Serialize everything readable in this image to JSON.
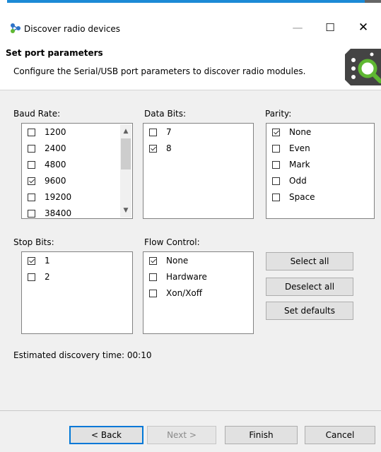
{
  "window": {
    "title": "Discover radio devices",
    "minimize_glyph": "—",
    "maximize_glyph": "☐",
    "close_glyph": "✕"
  },
  "header": {
    "title": "Set port parameters",
    "description": "Configure the Serial/USB port parameters to discover radio modules."
  },
  "baud_rate": {
    "label": "Baud Rate:",
    "items": [
      {
        "label": "1200",
        "checked": false
      },
      {
        "label": "2400",
        "checked": false
      },
      {
        "label": "4800",
        "checked": false
      },
      {
        "label": "9600",
        "checked": true
      },
      {
        "label": "19200",
        "checked": false
      },
      {
        "label": "38400",
        "checked": false
      }
    ]
  },
  "data_bits": {
    "label": "Data Bits:",
    "items": [
      {
        "label": "7",
        "checked": false
      },
      {
        "label": "8",
        "checked": true
      }
    ]
  },
  "parity": {
    "label": "Parity:",
    "items": [
      {
        "label": "None",
        "checked": true
      },
      {
        "label": "Even",
        "checked": false
      },
      {
        "label": "Mark",
        "checked": false
      },
      {
        "label": "Odd",
        "checked": false
      },
      {
        "label": "Space",
        "checked": false
      }
    ]
  },
  "stop_bits": {
    "label": "Stop Bits:",
    "items": [
      {
        "label": "1",
        "checked": true
      },
      {
        "label": "2",
        "checked": false
      }
    ]
  },
  "flow_control": {
    "label": "Flow Control:",
    "items": [
      {
        "label": "None",
        "checked": true
      },
      {
        "label": "Hardware",
        "checked": false
      },
      {
        "label": "Xon/Xoff",
        "checked": false
      }
    ]
  },
  "actions": {
    "select_all": "Select all",
    "deselect_all": "Deselect all",
    "set_defaults": "Set defaults"
  },
  "estimate": {
    "text": "Estimated discovery time: 00:10"
  },
  "footer": {
    "back": "< Back",
    "next": "Next >",
    "finish": "Finish",
    "cancel": "Cancel"
  },
  "colors": {
    "accent": "#0078d7",
    "header_icon_bg": "#444444",
    "search_green": "#5fb832"
  },
  "icons": {
    "app": "radio-network-icon",
    "header": "radio-module-search-icon",
    "scroll_up": "scroll-up-arrow-icon",
    "scroll_down": "scroll-down-arrow-icon"
  }
}
